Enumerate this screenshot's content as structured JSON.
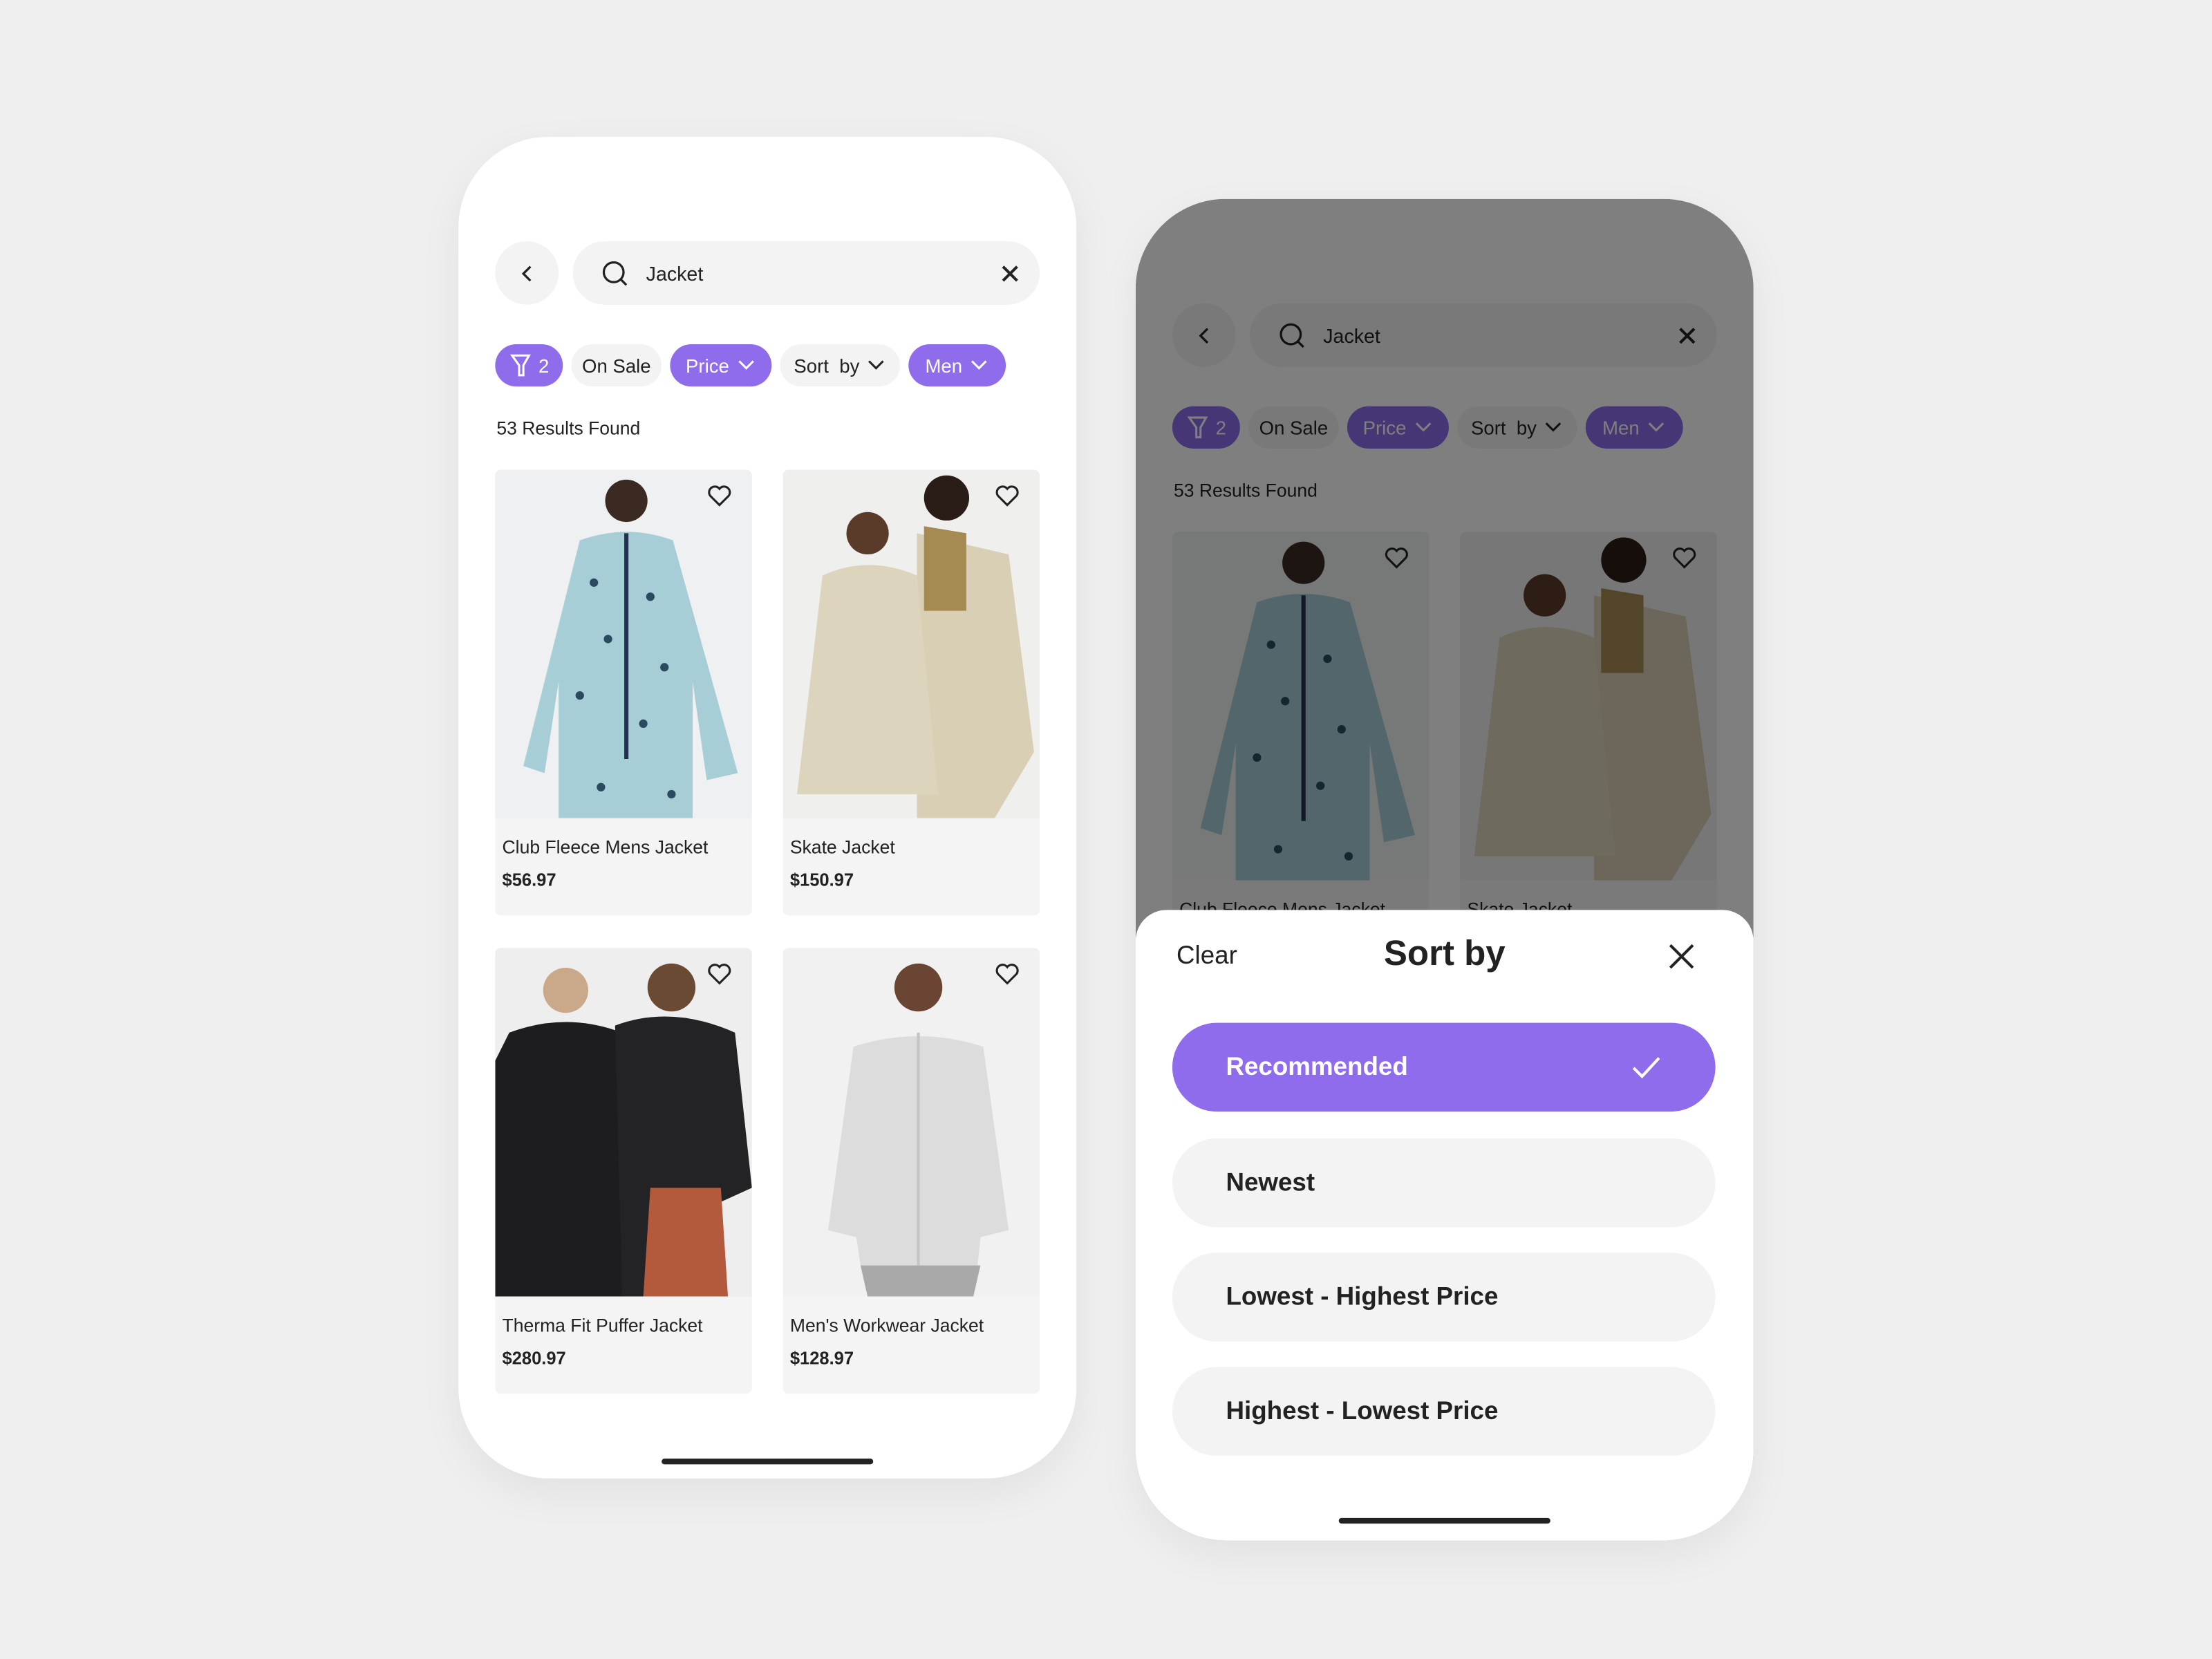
{
  "accent_color": "#8e6ceb",
  "search": {
    "query": "Jacket"
  },
  "filters": {
    "filter_count": "2",
    "on_sale": "On Sale",
    "price": "Price",
    "sort_by": "Sort  by",
    "men": "Men"
  },
  "results_text": "53 Results Found",
  "products": [
    {
      "name": "Club Fleece Mens Jacket",
      "price": "$56.97"
    },
    {
      "name": "Skate Jacket",
      "price": "$150.97"
    },
    {
      "name": "Therma Fit Puffer Jacket",
      "price": "$280.97"
    },
    {
      "name": "Men's Workwear Jacket",
      "price": "$128.97"
    }
  ],
  "sort_sheet": {
    "clear_label": "Clear",
    "title": "Sort by",
    "options": [
      {
        "label": "Recommended",
        "selected": true
      },
      {
        "label": "Newest",
        "selected": false
      },
      {
        "label": "Lowest - Highest Price",
        "selected": false
      },
      {
        "label": "Highest - Lowest Price",
        "selected": false
      }
    ]
  }
}
